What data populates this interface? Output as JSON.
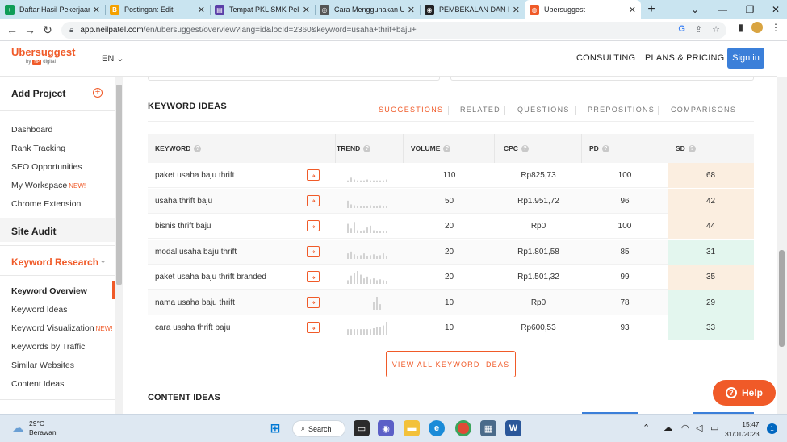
{
  "browser": {
    "tabs": [
      {
        "title": "Daftar Hasil Pekerjaan",
        "fav_color": "#0f9d58",
        "fav_glyph": "+",
        "active": false
      },
      {
        "title": "Postingan: Edit",
        "fav_color": "#f4a100",
        "fav_glyph": "B",
        "active": false
      },
      {
        "title": "Tempat PKL SMK Pekalongan",
        "fav_color": "#5b3fa8",
        "fav_glyph": "▤",
        "active": false
      },
      {
        "title": "Cara Menggunakan Ubersuggest",
        "fav_color": "#555555",
        "fav_glyph": "◎",
        "active": false
      },
      {
        "title": "PEMBEKALAN DAN PKL",
        "fav_color": "#202124",
        "fav_glyph": "◉",
        "active": false
      },
      {
        "title": "Ubersuggest",
        "fav_color": "#f05a28",
        "fav_glyph": "◍",
        "active": true
      }
    ],
    "url_host": "app.neilpatel.com",
    "url_path": "/en/ubersuggest/overview?lang=id&locId=2360&keyword=usaha+thrif+baju+"
  },
  "header": {
    "brand": "Ubersuggest",
    "by": "by",
    "np_badge": "NP",
    "digital": "digital",
    "lang": "EN",
    "consulting": "CONSULTING",
    "plans": "PLANS & PRICING",
    "signin": "Sign in"
  },
  "sidebar": {
    "add_project": "Add Project",
    "project_items": [
      "Dashboard",
      "Rank Tracking",
      "SEO Opportunities",
      "My Workspace",
      "Chrome Extension"
    ],
    "new_badge": "NEW!",
    "site_audit": "Site Audit",
    "keyword_research": "Keyword Research",
    "kr_items": [
      "Keyword Overview",
      "Keyword Ideas",
      "Keyword Visualization",
      "Keywords by Traffic",
      "Similar Websites",
      "Content Ideas"
    ]
  },
  "keyword_ideas": {
    "title": "KEYWORD IDEAS",
    "tabs": [
      "SUGGESTIONS",
      "RELATED",
      "QUESTIONS",
      "PREPOSITIONS",
      "COMPARISONS"
    ],
    "columns": [
      "KEYWORD",
      "TREND",
      "VOLUME",
      "CPC",
      "PD",
      "SD"
    ],
    "rows": [
      {
        "keyword": "paket usaha baju thrift",
        "volume": "110",
        "cpc": "Rp825,73",
        "pd": "100",
        "sd": "68",
        "sd_color": "#fbeee0",
        "trend": [
          2,
          5,
          3,
          2,
          2,
          2,
          3,
          2,
          2,
          2,
          2,
          2,
          3
        ]
      },
      {
        "keyword": "usaha thrift baju",
        "volume": "50",
        "cpc": "Rp1.951,72",
        "pd": "96",
        "sd": "42",
        "sd_color": "#fbeee0",
        "trend": [
          8,
          4,
          3,
          2,
          2,
          2,
          2,
          3,
          2,
          2,
          3,
          2,
          2
        ]
      },
      {
        "keyword": "bisnis thrift baju",
        "volume": "20",
        "cpc": "Rp0",
        "pd": "100",
        "sd": "44",
        "sd_color": "#fbeee0",
        "trend": [
          10,
          5,
          12,
          3,
          2,
          3,
          6,
          8,
          3,
          2,
          2,
          2,
          2
        ]
      },
      {
        "keyword": "modal usaha baju thrift",
        "volume": "20",
        "cpc": "Rp1.801,58",
        "pd": "85",
        "sd": "31",
        "sd_color": "#e3f6ee",
        "trend": [
          6,
          8,
          5,
          3,
          4,
          6,
          3,
          4,
          5,
          3,
          4,
          6,
          3
        ]
      },
      {
        "keyword": "paket usaha baju thrift branded",
        "volume": "20",
        "cpc": "Rp1.501,32",
        "pd": "99",
        "sd": "35",
        "sd_color": "#fbeee0",
        "trend": [
          4,
          9,
          12,
          14,
          10,
          6,
          8,
          5,
          6,
          4,
          5,
          4,
          3
        ]
      },
      {
        "keyword": "nama usaha baju thrift",
        "volume": "10",
        "cpc": "Rp0",
        "pd": "78",
        "sd": "29",
        "sd_color": "#e3f6ee",
        "trend": [
          0,
          0,
          0,
          0,
          0,
          0,
          0,
          0,
          8,
          14,
          6,
          0,
          0
        ]
      },
      {
        "keyword": "cara usaha thrift baju",
        "volume": "10",
        "cpc": "Rp600,53",
        "pd": "93",
        "sd": "33",
        "sd_color": "#e3f6ee",
        "trend": [
          6,
          6,
          6,
          6,
          6,
          6,
          6,
          6,
          7,
          8,
          8,
          10,
          14
        ]
      }
    ],
    "view_all": "VIEW ALL KEYWORD IDEAS"
  },
  "content_ideas": {
    "title": "CONTENT IDEAS"
  },
  "help": {
    "label": "Help"
  },
  "taskbar": {
    "temp": "29°C",
    "weather": "Berawan",
    "search": "Search",
    "time": "15:47",
    "date": "31/01/2023",
    "notif_count": "1"
  }
}
